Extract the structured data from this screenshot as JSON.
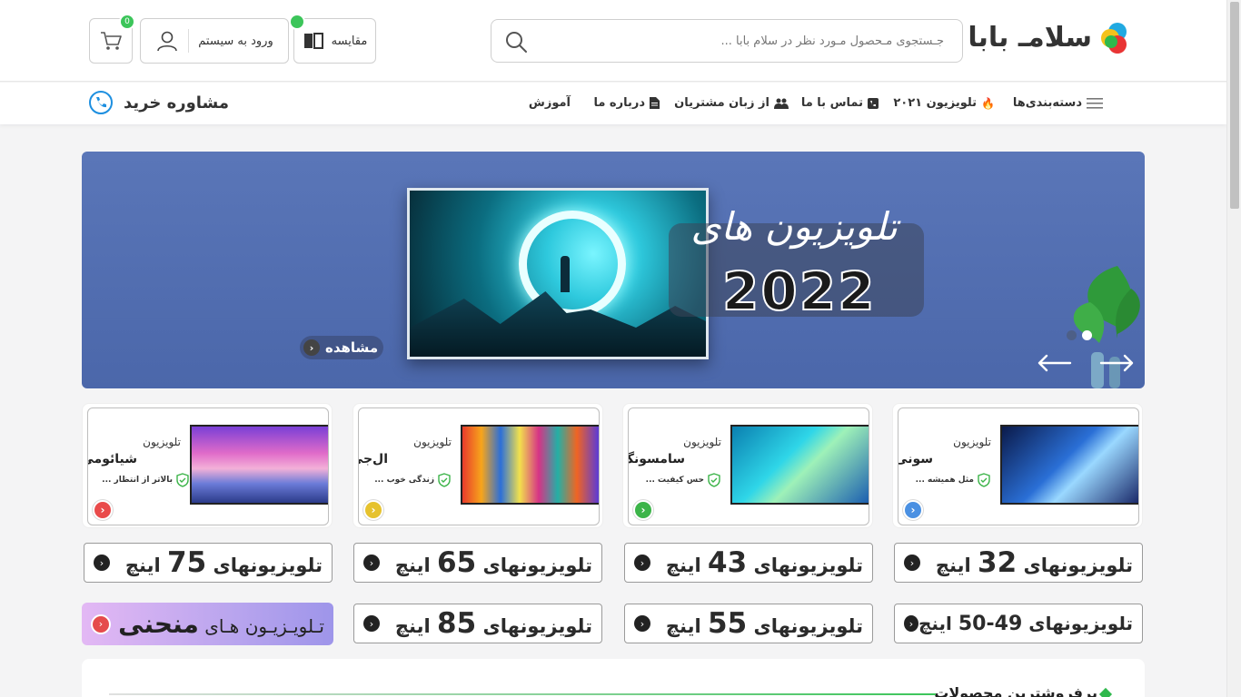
{
  "header": {
    "logo_text": "سلامـ بابا",
    "search_placeholder": "جـستجوی مـحصول مـورد نظر در سلام بابا ...",
    "compare_label": "مقایسه",
    "login_label": "ورود به سیستم",
    "cart_count": "0"
  },
  "nav": {
    "items": [
      {
        "label": "دسته‌بندی‌ها",
        "icon": "menu-icon"
      },
      {
        "label": "تلویزیون ۲۰۲۱",
        "icon": "fire-icon"
      },
      {
        "label": "تماس با ما",
        "icon": "phone-icon"
      },
      {
        "label": "از زبان مشتریان",
        "icon": "users-icon"
      },
      {
        "label": "درباره ما",
        "icon": "document-icon"
      },
      {
        "label": "آموزش",
        "icon": ""
      }
    ],
    "consult_label": "مشاوره خرید"
  },
  "hero": {
    "title": "تلویزیون های",
    "year": "2022",
    "view_label": "مشاهده"
  },
  "brands": [
    {
      "line1": "تلویزیون",
      "brand": "سونی",
      "tagline": "مثل همیشه ...",
      "accent": "#4a90e2"
    },
    {
      "line1": "تلویزیون",
      "brand": "سامسونگ",
      "tagline": "حس کیفیت ...",
      "accent": "#3cb449"
    },
    {
      "line1": "تلویزیون",
      "brand": "ال‌جی",
      "tagline": "زندگی خوب ...",
      "accent": "#e6c22e"
    },
    {
      "line1": "تلویزیون",
      "brand": "شیائومی",
      "tagline": "بالاتر از انتظار ...",
      "accent": "#e94b4b"
    }
  ],
  "sizes": [
    {
      "prefix": "تلویزیونهای",
      "size": "32",
      "suffix": "اینچ"
    },
    {
      "prefix": "تلویزیونهای",
      "size": "43",
      "suffix": "اینچ"
    },
    {
      "prefix": "تلویزیونهای",
      "size": "65",
      "suffix": "اینچ"
    },
    {
      "prefix": "تلویزیونهای",
      "size": "75",
      "suffix": "اینچ"
    },
    {
      "prefix": "تلویزیونهای",
      "size": "49-50",
      "suffix": "اینچ"
    },
    {
      "prefix": "تلویزیونهای",
      "size": "55",
      "suffix": "اینچ"
    },
    {
      "prefix": "تلویزیونهای",
      "size": "85",
      "suffix": "اینچ"
    },
    {
      "prefix": "تـلویـزیـون هـای",
      "size": "منحنی",
      "suffix": ""
    }
  ],
  "bestsellers": {
    "title": "پرفروشترین محصولات"
  }
}
